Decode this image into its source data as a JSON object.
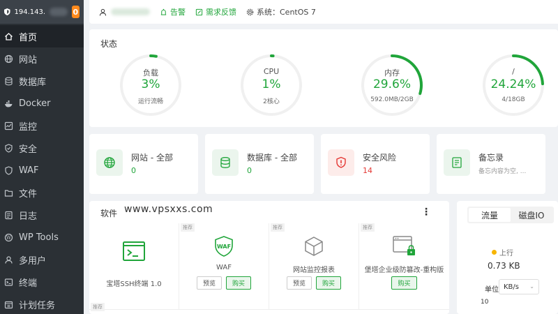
{
  "sidebar": {
    "ip": "194.143.",
    "badge": "0",
    "items": [
      {
        "label": "首页",
        "icon": "home-icon",
        "active": true
      },
      {
        "label": "网站",
        "icon": "globe-icon"
      },
      {
        "label": "数据库",
        "icon": "database-icon"
      },
      {
        "label": "Docker",
        "icon": "docker-icon"
      },
      {
        "label": "监控",
        "icon": "monitor-icon"
      },
      {
        "label": "安全",
        "icon": "shield-icon"
      },
      {
        "label": "WAF",
        "icon": "waf-shield-icon"
      },
      {
        "label": "文件",
        "icon": "folder-icon"
      },
      {
        "label": "日志",
        "icon": "log-icon"
      },
      {
        "label": "WP Tools",
        "icon": "wordpress-icon"
      },
      {
        "label": "多用户",
        "icon": "users-icon"
      },
      {
        "label": "终端",
        "icon": "terminal-icon"
      },
      {
        "label": "计划任务",
        "icon": "calendar-icon"
      }
    ]
  },
  "topbar": {
    "alarm": "告警",
    "feedback": "需求反馈",
    "system": "系统：CentOS 7"
  },
  "status": {
    "title": "状态",
    "gauges": [
      {
        "name": "负载",
        "value": "3%",
        "sub": "运行流畅",
        "percent": 0.03
      },
      {
        "name": "CPU",
        "value": "1%",
        "sub": "2核心",
        "percent": 0.01
      },
      {
        "name": "内存",
        "value": "29.6%",
        "sub": "592.0MB/2GB",
        "percent": 0.296
      },
      {
        "name": "/",
        "value": "24.24%",
        "sub": "4/18GB",
        "percent": 0.2424
      }
    ]
  },
  "overview": [
    {
      "title": "网站 - 全部",
      "value": "0"
    },
    {
      "title": "数据库 - 全部",
      "value": "0"
    },
    {
      "title": "安全风险",
      "value": "14"
    },
    {
      "title": "备忘录",
      "value": "备忘内容为空, ..."
    }
  ],
  "software": {
    "title": "软件",
    "watermark": "www.vpsxxs.com",
    "tag": "推荐",
    "items": [
      {
        "name": "宝塔SSH终端 1.0"
      },
      {
        "name": "WAF",
        "preview": "预览",
        "buy": "购买"
      },
      {
        "name": "网站监控报表",
        "preview": "预览",
        "buy": "购买"
      },
      {
        "name": "堡塔企业级防篡改-重构版",
        "buy": "购买"
      }
    ]
  },
  "traffic": {
    "tabs": [
      "流量",
      "磁盘IO"
    ],
    "up_label": "上行",
    "up_value": "0.73 KB",
    "unit_label": "单位",
    "unit_value": "KB/s",
    "axis_tick": "10"
  },
  "colors": {
    "accent": "#20a53a",
    "danger": "#e53935",
    "sidebar": "#2b3035"
  }
}
